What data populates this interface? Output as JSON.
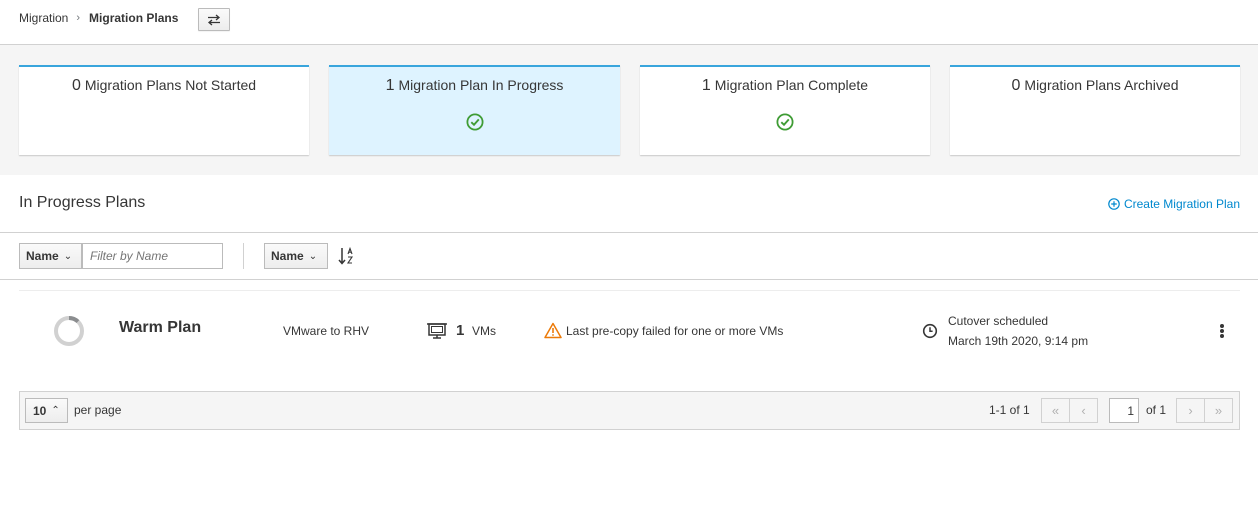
{
  "breadcrumb": {
    "parent": "Migration",
    "separator": "›",
    "current": "Migration Plans"
  },
  "swap_button_icon": "swap-arrows-icon",
  "cards": [
    {
      "count": "0",
      "label": "Migration Plans Not Started",
      "icon": null,
      "active": false
    },
    {
      "count": "1",
      "label": "Migration Plan In Progress",
      "icon": "check-circle-icon",
      "active": true
    },
    {
      "count": "1",
      "label": "Migration Plan Complete",
      "icon": "check-circle-icon",
      "active": false
    },
    {
      "count": "0",
      "label": "Migration Plans Archived",
      "icon": null,
      "active": false
    }
  ],
  "section": {
    "title": "In Progress Plans",
    "create_label": "Create Migration Plan"
  },
  "toolbar": {
    "filter_field": "Name",
    "filter_placeholder": "Filter by Name",
    "sort_field": "Name"
  },
  "plans": [
    {
      "name": "Warm Plan",
      "description": "VMware to RHV",
      "vm_count": "1",
      "vm_label": "VMs",
      "warning": "Last pre-copy failed for one or more VMs",
      "schedule_label": "Cutover scheduled",
      "schedule_date": "March 19th 2020, 9:14 pm",
      "progress": 0.12
    }
  ],
  "pagination": {
    "per_page": "10",
    "per_page_label": "per page",
    "range": "1-1 of 1",
    "current_page": "1",
    "total_pages": "of 1"
  },
  "colors": {
    "accent": "#39a5dc",
    "link": "#0088ce",
    "success": "#3f9c35",
    "warning": "#ec7a08",
    "active_card_bg": "#def3ff"
  }
}
